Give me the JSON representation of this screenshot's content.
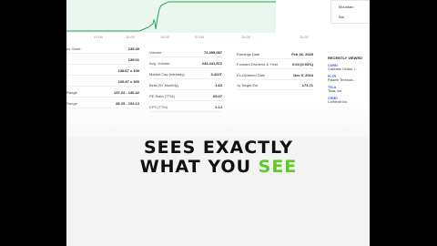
{
  "chart": {
    "time_ticks": [
      "07:00",
      "11:00",
      "15:00",
      "07:00",
      "15:00",
      "11:00"
    ]
  },
  "side_panel": {
    "item1": "Mountain",
    "item2": "Bar"
  },
  "stats": {
    "col1": [
      {
        "key": "ev Close",
        "value": "139.40"
      },
      {
        "key": "",
        "value": "139.01"
      },
      {
        "key": "",
        "value": "138.67 x 100"
      },
      {
        "key": "",
        "value": "139.87 x 300"
      },
      {
        "key": "Range",
        "value": "137.23 - 140.42"
      },
      {
        "key": "Range",
        "value": "88.25 - 153.13"
      }
    ],
    "col2": [
      {
        "key": "Volume",
        "value": "73,399,087"
      },
      {
        "key": "Avg. Volume",
        "value": "244,441,572"
      },
      {
        "key": "Market Cap (intraday)",
        "value": "3.422T"
      },
      {
        "key": "Beta (5Y Monthly)",
        "value": "1.63"
      },
      {
        "key": "PE Ratio (TTM)",
        "value": "65.07"
      },
      {
        "key": "EPS (TTM)",
        "value": "2.14"
      }
    ],
    "col3": [
      {
        "key": "Earnings Date",
        "value": "Feb 26, 2025"
      },
      {
        "key": "Forward Dividend & Yield",
        "value": "0.04 (0.03%)"
      },
      {
        "key": "Ex-Dividend Date",
        "value": "Dec 5, 2024"
      },
      {
        "key": "1y Target Est",
        "value": "173.71"
      }
    ]
  },
  "recent": {
    "title": "RECENTLY VIEWED",
    "items": [
      {
        "sym": "CORN",
        "name": "Coinbase Global, I...",
        "pct": "",
        "neg": false
      },
      {
        "sym": "PLTR",
        "name": "Palantir Technolo...",
        "pct": "",
        "neg": true
      },
      {
        "sym": "TSLA",
        "name": "Tesla, Inc.",
        "pct": "",
        "neg": false
      },
      {
        "sym": "CRMD",
        "name": "CorMedix Inc.",
        "pct": "",
        "neg": false
      }
    ]
  },
  "caption": {
    "line1": "SEES EXACTLY",
    "line2_a": "WHAT YOU ",
    "line2_b": "SEE"
  },
  "colors": {
    "highlight": "#5ecb23",
    "positive": "#0a7d3a",
    "negative": "#c51d1d"
  }
}
